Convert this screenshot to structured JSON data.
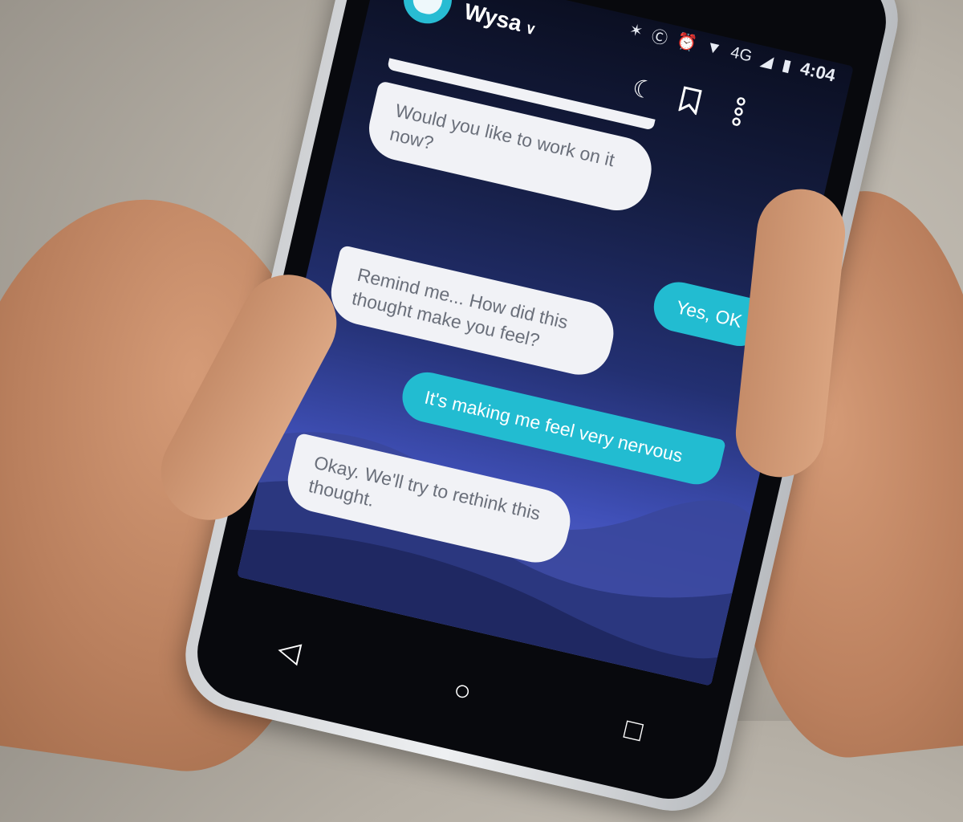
{
  "status_bar": {
    "network": "4G",
    "time": "4:04"
  },
  "app_bar": {
    "title": "Wysa",
    "title_dropdown_icon": "chevron-down-icon",
    "icons": [
      "moon-icon",
      "bookmark-icon",
      "more-vertical-icon"
    ]
  },
  "chat": {
    "messages": [
      {
        "from": "bot",
        "text": "Would you like to work on it now?"
      },
      {
        "from": "user",
        "text": "Yes, OK"
      },
      {
        "from": "bot",
        "text": "Remind me... How did this thought make you feel?"
      },
      {
        "from": "user",
        "text": "It's making me feel very nervous"
      },
      {
        "from": "bot",
        "text": "Okay. We'll try to rethink this thought."
      }
    ]
  },
  "nav_bar": {
    "icons": [
      "back-icon",
      "home-icon",
      "recents-icon"
    ]
  },
  "colors": {
    "user_bubble": "#22bcd1",
    "bot_bubble": "#f1f2f6",
    "accent": "#28bcd3"
  }
}
